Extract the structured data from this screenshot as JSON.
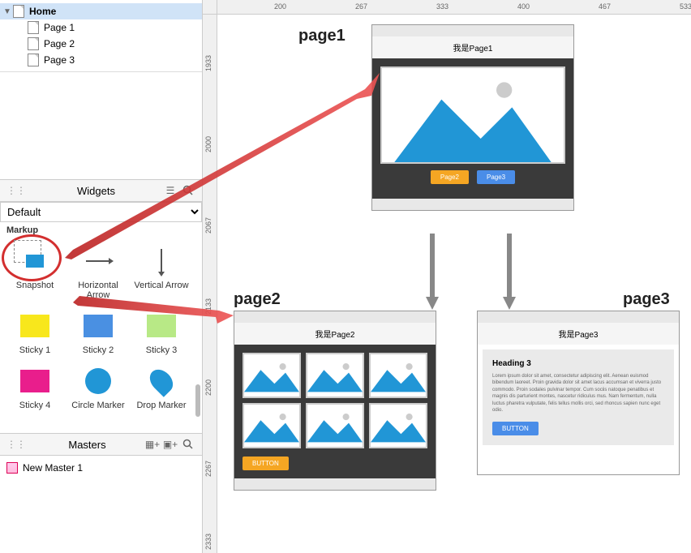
{
  "pages_tree": {
    "root": "Home",
    "children": [
      "Page 1",
      "Page 2",
      "Page 3"
    ]
  },
  "widgets_panel": {
    "title": "Widgets",
    "library_select": "Default",
    "section": "Markup",
    "items": [
      {
        "id": "snapshot",
        "label": "Snapshot"
      },
      {
        "id": "h-arrow",
        "label": "Horizontal Arrow"
      },
      {
        "id": "v-arrow",
        "label": "Vertical Arrow"
      },
      {
        "id": "sticky1",
        "label": "Sticky 1"
      },
      {
        "id": "sticky2",
        "label": "Sticky 2"
      },
      {
        "id": "sticky3",
        "label": "Sticky 3"
      },
      {
        "id": "sticky4",
        "label": "Sticky 4"
      },
      {
        "id": "circle-marker",
        "label": "Circle Marker"
      },
      {
        "id": "drop-marker",
        "label": "Drop Marker"
      }
    ]
  },
  "masters_panel": {
    "title": "Masters",
    "items": [
      "New Master 1"
    ]
  },
  "ruler_h": [
    "200",
    "267",
    "333",
    "400",
    "467",
    "533"
  ],
  "ruler_v": [
    "1933",
    "2000",
    "2067",
    "2133",
    "2200",
    "2267",
    "2333"
  ],
  "canvas_labels": {
    "page1": "page1",
    "page2": "page2",
    "page3": "page3"
  },
  "mockups": {
    "page1": {
      "title": "我是Page1",
      "buttons": [
        "Page2",
        "Page3"
      ]
    },
    "page2": {
      "title": "我是Page2",
      "button": "BUTTON"
    },
    "page3": {
      "title": "我是Page3",
      "heading": "Heading 3",
      "body": "Lorem ipsum dolor sit amet, consectetur adipiscing elit. Aenean euismod bibendum laoreet. Proin gravida dolor sit amet lacus accumsan et viverra justo commodo. Proin sodales pulvinar tempor. Cum sociis natoque penatibus et magnis dis parturient montes, nascetur ridiculus mus. Nam fermentum, nulla luctus pharetra vulputate, felis tellus mollis orci, sed rhoncus sapien nunc eget odio.",
      "button": "BUTTON"
    }
  }
}
